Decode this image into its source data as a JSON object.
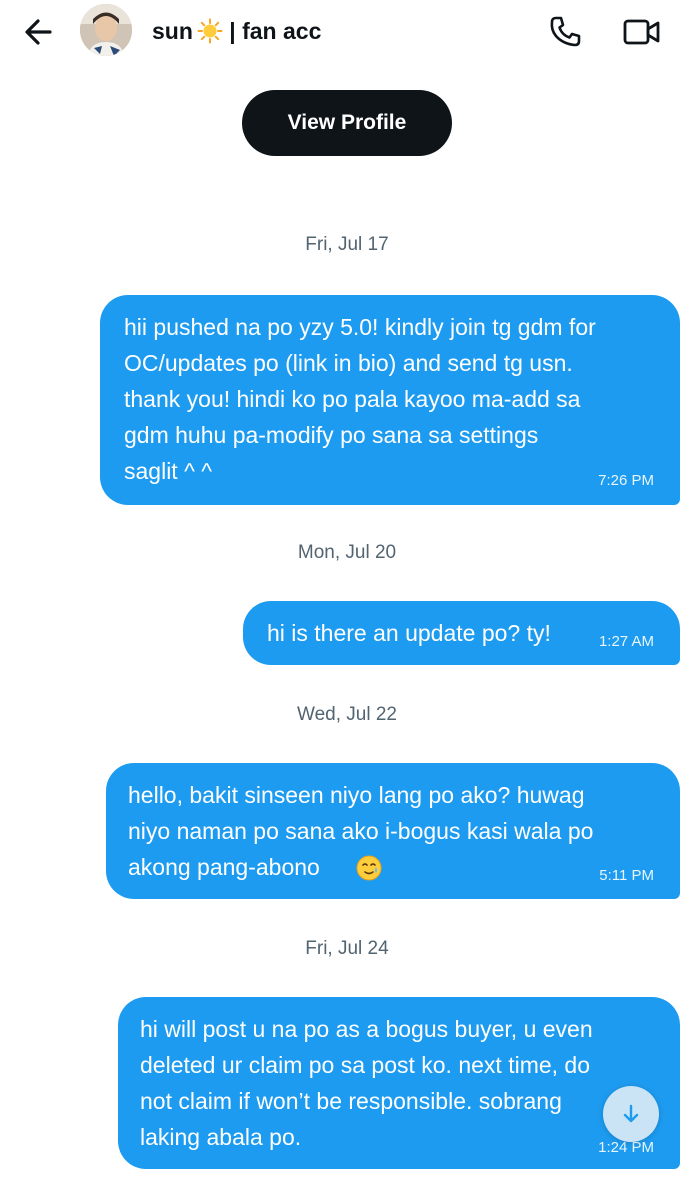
{
  "header": {
    "back_icon": "arrow-left-icon",
    "display_name": "sun",
    "name_emoji_icon": "sun-emoji-icon",
    "name_suffix": " | fan acc",
    "call_icon": "phone-icon",
    "video_icon": "video-camera-icon"
  },
  "profile": {
    "view_profile_label": "View Profile"
  },
  "conversation": [
    {
      "date": "Fri, Jul 17",
      "message": "hii pushed na po yzy 5.0! kindly join tg gdm for\nOC/updates po (link in bio) and send tg usn.\nthank you! hindi ko po pala kayoo ma-add sa\ngdm huhu pa-modify po sana sa settings\nsaglit ^ ^",
      "time": "7:26 PM"
    },
    {
      "date": "Mon, Jul 20",
      "message": "hi is there an update po? ty!",
      "time": "1:27 AM"
    },
    {
      "date": "Wed, Jul 22",
      "message": "hello, bakit sinseen niyo lang po ako? huwag\nniyo naman po sana ako i-bogus kasi wala po\nakong pang-abono",
      "emoji": "smiling-face-with-tear-emoji",
      "time": "5:11 PM"
    },
    {
      "date": "Fri, Jul 24",
      "message": "hi will post u na po as a bogus buyer, u even\ndeleted ur claim po sa post ko. next time, do\nnot claim if won’t be responsible. sobrang\nlaking abala po.",
      "time": "1:24 PM"
    }
  ],
  "scroll_button_icon": "arrow-down-icon",
  "colors": {
    "bubble": "#1d9bf0",
    "button": "#0f1419",
    "date_text": "#536471"
  }
}
